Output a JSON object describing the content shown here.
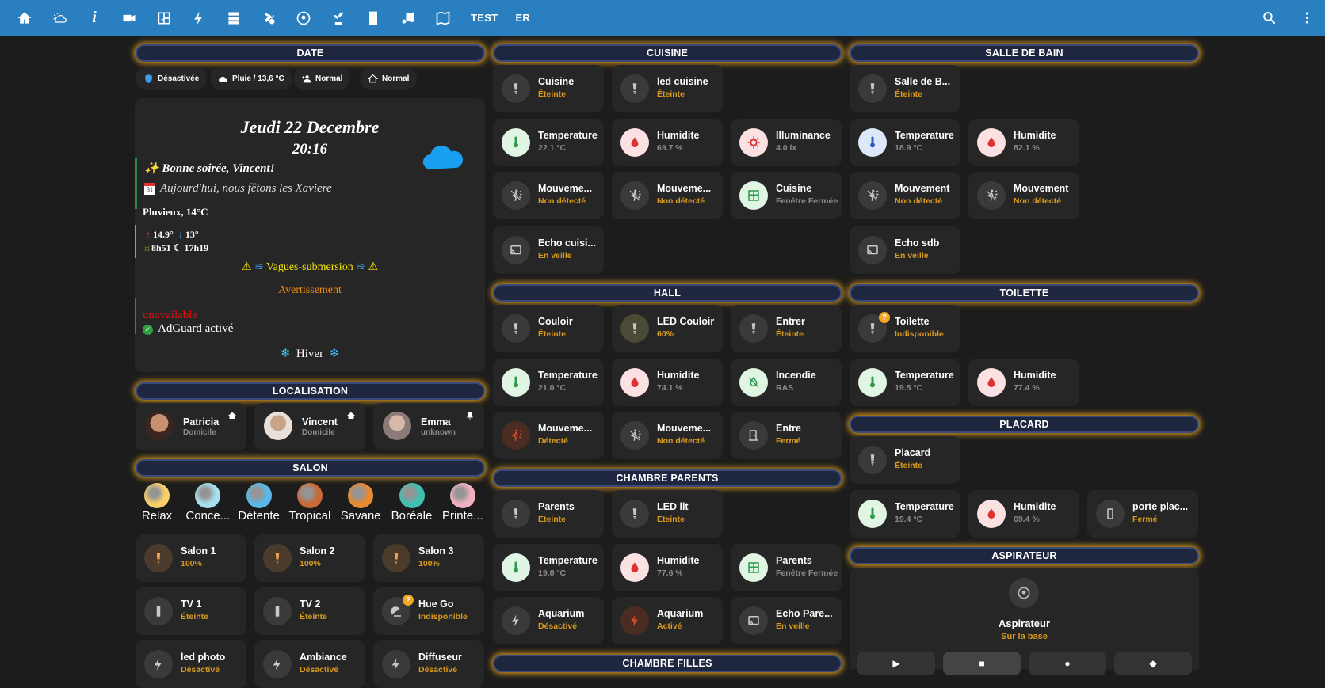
{
  "topbar": {
    "icons": [
      "home-icon",
      "weather-icon",
      "info-icon",
      "camera-icon",
      "floorplan-icon",
      "energy-icon",
      "server-icon",
      "tools-icon",
      "robot-vacuum-icon",
      "sprout-icon",
      "door-icon",
      "music-icon",
      "map-icon"
    ],
    "tab_test": "TEST",
    "tab_er": "ER",
    "color": "#2a7fc0"
  },
  "headers": {
    "date": "DATE",
    "localisation": "LOCALISATION",
    "salon": "SALON",
    "cuisine": "CUISINE",
    "hall": "HALL",
    "chambre_parents": "CHAMBRE PARENTS",
    "chambre_filles": "CHAMBRE FILLES",
    "salle_de_bain": "SALLE DE BAIN",
    "toilette": "TOILETTE",
    "placard": "PLACARD",
    "aspirateur": "ASPIRATEUR"
  },
  "chips": [
    "Désactivée",
    "Pluie / 13,6 °C",
    "Normal",
    "Normal"
  ],
  "datecard": {
    "date": "Jeudi 22 Decembre",
    "time": "20:16",
    "greeting": "✨ Bonne soirée, Vincent!",
    "fete": "Aujourd'hui, nous fêtons les Xaviere",
    "calendar_day": "31",
    "weather": "Pluvieux, 14°C",
    "temp_hi": "14.9°",
    "temp_lo": "13°",
    "sunrise": "8h51",
    "sunset": "17h19",
    "alert": "Vagues-submersion",
    "alert_level": "Avertissement",
    "unavailable": "unavailable",
    "adguard": "AdGuard activé",
    "season": "Hiver"
  },
  "people": [
    {
      "name": "Patricia",
      "state": "Domicile"
    },
    {
      "name": "Vincent",
      "state": "Domicile"
    },
    {
      "name": "Emma",
      "state": "unknown"
    }
  ],
  "scenes": [
    "Relax",
    "Conce...",
    "Détente",
    "Tropical",
    "Savane",
    "Boréale",
    "Printe..."
  ],
  "salon": [
    {
      "name": "Salon 1",
      "state": "100%"
    },
    {
      "name": "Salon 2",
      "state": "100%"
    },
    {
      "name": "Salon 3",
      "state": "100%"
    },
    {
      "name": "TV 1",
      "state": "Éteinte"
    },
    {
      "name": "TV 2",
      "state": "Éteinte"
    },
    {
      "name": "Hue Go",
      "state": "Indisponible"
    },
    {
      "name": "led photo",
      "state": "Désactivé"
    },
    {
      "name": "Ambiance",
      "state": "Désactivé"
    },
    {
      "name": "Diffuseur",
      "state": "Désactivé"
    }
  ],
  "cuisine": [
    {
      "name": "Cuisine",
      "state": "Éteinte"
    },
    {
      "name": "led cuisine",
      "state": "Éteinte"
    },
    {
      "name": "Temperature",
      "state": "22.1 °C"
    },
    {
      "name": "Humidite",
      "state": "69.7 %"
    },
    {
      "name": "Illuminance",
      "state": "4.0 lx"
    },
    {
      "name": "Mouveme...",
      "state": "Non détecté"
    },
    {
      "name": "Mouveme...",
      "state": "Non détecté"
    },
    {
      "name": "Cuisine",
      "state": "Fenêtre Fermée"
    },
    {
      "name": "Echo cuisi...",
      "state": "En veille"
    }
  ],
  "hall": [
    {
      "name": "Couloir",
      "state": "Éteinte"
    },
    {
      "name": "LED Couloir",
      "state": "60%"
    },
    {
      "name": "Entrer",
      "state": "Éteinte"
    },
    {
      "name": "Temperature",
      "state": "21.0 °C"
    },
    {
      "name": "Humidite",
      "state": "74.1 %"
    },
    {
      "name": "Incendie",
      "state": "RAS"
    },
    {
      "name": "Mouveme...",
      "state": "Détecté"
    },
    {
      "name": "Mouveme...",
      "state": "Non détecté"
    },
    {
      "name": "Entre",
      "state": "Fermé"
    }
  ],
  "parents": [
    {
      "name": "Parents",
      "state": "Éteinte"
    },
    {
      "name": "LED lit",
      "state": "Éteinte"
    },
    {
      "name": "Temperature",
      "state": "19.8 °C"
    },
    {
      "name": "Humidite",
      "state": "77.6 %"
    },
    {
      "name": "Parents",
      "state": "Fenêtre Fermée"
    },
    {
      "name": "Aquarium",
      "state": "Désactivé"
    },
    {
      "name": "Aquarium",
      "state": "Activé"
    },
    {
      "name": "Echo Pare...",
      "state": "En veille"
    }
  ],
  "sdb": [
    {
      "name": "Salle de B...",
      "state": "Éteinte"
    },
    {
      "name": "Temperature",
      "state": "18.9 °C"
    },
    {
      "name": "Humidite",
      "state": "82.1 %"
    },
    {
      "name": "Mouvement",
      "state": "Non détecté"
    },
    {
      "name": "Mouvement",
      "state": "Non détecté"
    },
    {
      "name": "Echo sdb",
      "state": "En veille"
    }
  ],
  "toilette": [
    {
      "name": "Toilette",
      "state": "Indisponible"
    },
    {
      "name": "Temperature",
      "state": "19.5 °C"
    },
    {
      "name": "Humidite",
      "state": "77.4 %"
    }
  ],
  "placard": [
    {
      "name": "Placard",
      "state": "Éteinte"
    },
    {
      "name": "Temperature",
      "state": "19.4 °C"
    },
    {
      "name": "Humidite",
      "state": "69.4 %"
    },
    {
      "name": "porte plac...",
      "state": "Fermé"
    }
  ],
  "aspirateur": {
    "name": "Aspirateur",
    "state": "Sur la base"
  },
  "colors": {
    "accent": "#d99b1e",
    "header_glow": "#d99b1e",
    "state_grey": "#8c8c8c"
  }
}
